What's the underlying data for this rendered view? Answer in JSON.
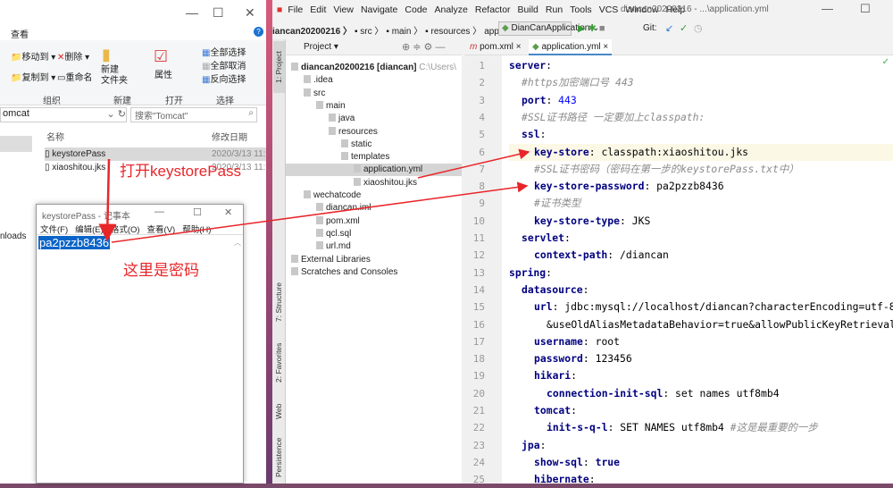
{
  "explorer": {
    "ribbon_tab": "查看",
    "move_to": "移动到",
    "delete": "删除",
    "copy_to": "复制到",
    "rename": "重命名",
    "new_folder": "新建\n文件夹",
    "properties": "属性",
    "select_all": "全部选择",
    "select_none": "全部取消",
    "invert_select": "反向选择",
    "group_organize": "组织",
    "group_new": "新建",
    "group_open": "打开",
    "group_select": "选择",
    "address": "omcat",
    "search_placeholder": "搜索\"Tomcat\"",
    "col_name": "名称",
    "col_date": "修改日期",
    "nav_item": "nloads",
    "files": [
      {
        "name": "keystorePass",
        "date": "2020/3/13 11:"
      },
      {
        "name": "xiaoshitou.jks",
        "date": "2020/3/13 11:"
      }
    ]
  },
  "notepad": {
    "title": "keystorePass - 记事本",
    "menu": [
      "文件(F)",
      "编辑(E)",
      "格式(O)",
      "查看(V)",
      "帮助(H)"
    ],
    "content": "pa2pzzb8436"
  },
  "annotations": {
    "open_note": "打开keystorePass",
    "password_note": "这里是密码",
    "color": "#e8262a"
  },
  "ide": {
    "menu": [
      "File",
      "Edit",
      "View",
      "Navigate",
      "Code",
      "Analyze",
      "Refactor",
      "Build",
      "Run",
      "Tools",
      "VCS",
      "Window",
      "Help"
    ],
    "title": "diancan20200216 - ...\\application.yml",
    "breadcrumb": [
      "iancan20200216",
      "src",
      "main",
      "resources",
      "application.yml"
    ],
    "run_config": "DianCanApplication",
    "git_label": "Git:",
    "project_label": "Project ▾",
    "tabs": [
      "pom.xml",
      "application.yml"
    ],
    "side_tabs": [
      "1: Project",
      "7: Structure",
      "2: Favorites",
      "Web",
      "Persistence"
    ],
    "tree": [
      {
        "d": 0,
        "label": "diancan20200216 [diancan]",
        "extra": "C:\\Users\\"
      },
      {
        "d": 1,
        "label": ".idea"
      },
      {
        "d": 1,
        "label": "src"
      },
      {
        "d": 2,
        "label": "main"
      },
      {
        "d": 3,
        "label": "java"
      },
      {
        "d": 3,
        "label": "resources"
      },
      {
        "d": 4,
        "label": "static"
      },
      {
        "d": 4,
        "label": "templates"
      },
      {
        "d": 5,
        "label": "application.yml",
        "sel": true
      },
      {
        "d": 5,
        "label": "xiaoshitou.jks"
      },
      {
        "d": 1,
        "label": "wechatcode"
      },
      {
        "d": 2,
        "label": "diancan.iml"
      },
      {
        "d": 2,
        "label": "pom.xml"
      },
      {
        "d": 2,
        "label": "qcl.sql"
      },
      {
        "d": 2,
        "label": "url.md"
      },
      {
        "d": 0,
        "label": "External Libraries"
      },
      {
        "d": 0,
        "label": "Scratches and Consoles"
      }
    ],
    "code": [
      [
        0,
        [
          [
            "server",
            "k"
          ],
          [
            ":",
            "v"
          ]
        ]
      ],
      [
        1,
        [
          [
            "#https加密端口号 443",
            "c"
          ]
        ]
      ],
      [
        1,
        [
          [
            "port",
            "k"
          ],
          [
            ": ",
            "v"
          ],
          [
            "443",
            "n"
          ]
        ]
      ],
      [
        1,
        [
          [
            "#SSL证书路径 一定要加上classpath:",
            "c"
          ]
        ]
      ],
      [
        1,
        [
          [
            "ssl",
            "k"
          ],
          [
            ":",
            "v"
          ]
        ]
      ],
      [
        2,
        [
          [
            "key-store",
            "k"
          ],
          [
            ": classpath:xiaoshitou.jks",
            "v"
          ]
        ]
      ],
      [
        2,
        [
          [
            "#SSL证书密码（密码在第一步的keystorePass.txt中）",
            "c"
          ]
        ]
      ],
      [
        2,
        [
          [
            "key-store-password",
            "k"
          ],
          [
            ": pa2pzzb8436",
            "v"
          ]
        ]
      ],
      [
        2,
        [
          [
            "#证书类型",
            "c"
          ]
        ]
      ],
      [
        2,
        [
          [
            "key-store-type",
            "k"
          ],
          [
            ": JKS",
            "v"
          ]
        ]
      ],
      [
        1,
        [
          [
            "servlet",
            "k"
          ],
          [
            ":",
            "v"
          ]
        ]
      ],
      [
        2,
        [
          [
            "context-path",
            "k"
          ],
          [
            ": /diancan",
            "v"
          ]
        ]
      ],
      [
        0,
        [
          [
            "spring",
            "k"
          ],
          [
            ":",
            "v"
          ]
        ]
      ],
      [
        1,
        [
          [
            "datasource",
            "k"
          ],
          [
            ":",
            "v"
          ]
        ]
      ],
      [
        2,
        [
          [
            "url",
            "k"
          ],
          [
            ": jdbc:mysql://localhost/diancan?characterEncoding=utf-8",
            "v"
          ]
        ]
      ],
      [
        3,
        [
          [
            "&useOldAliasMetadataBehavior=true&allowPublicKeyRetrieval",
            "v"
          ]
        ]
      ],
      [
        2,
        [
          [
            "username",
            "k"
          ],
          [
            ": root",
            "v"
          ]
        ]
      ],
      [
        2,
        [
          [
            "password",
            "k"
          ],
          [
            ": 123456",
            "v"
          ]
        ]
      ],
      [
        2,
        [
          [
            "hikari",
            "k"
          ],
          [
            ":",
            "v"
          ]
        ]
      ],
      [
        3,
        [
          [
            "connection-init-sql",
            "k"
          ],
          [
            ": set names utf8mb4",
            "v"
          ]
        ]
      ],
      [
        2,
        [
          [
            "tomcat",
            "k"
          ],
          [
            ":",
            "v"
          ]
        ]
      ],
      [
        3,
        [
          [
            "init-s-q-l",
            "k"
          ],
          [
            ": SET NAMES utf8mb4 ",
            "v"
          ],
          [
            "#这是最重要的一步",
            "c"
          ]
        ]
      ],
      [
        1,
        [
          [
            "jpa",
            "k"
          ],
          [
            ":",
            "v"
          ]
        ]
      ],
      [
        2,
        [
          [
            "show-sql",
            "k"
          ],
          [
            ": ",
            "v"
          ],
          [
            "true",
            "k"
          ]
        ]
      ],
      [
        2,
        [
          [
            "hibernate",
            "k"
          ],
          [
            ":",
            "v"
          ]
        ]
      ]
    ]
  }
}
